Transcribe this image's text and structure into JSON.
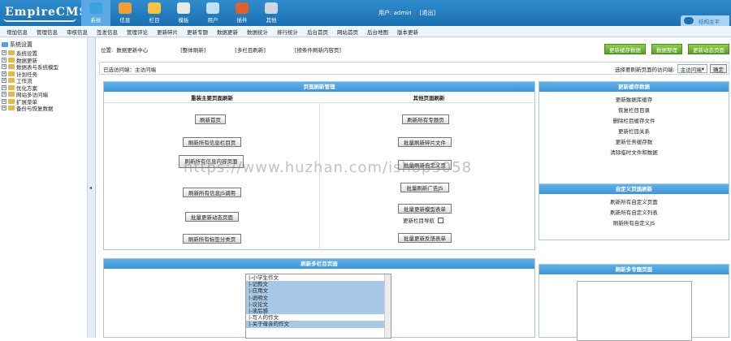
{
  "app": {
    "logo": "EmpireCMS"
  },
  "topnav": [
    {
      "label": "系统",
      "icon": "globe-icon",
      "color": "#3fa2e0"
    },
    {
      "label": "信息",
      "icon": "pencil-note-icon",
      "color": "#f0a030"
    },
    {
      "label": "栏目",
      "icon": "folder-icon",
      "color": "#f5c542"
    },
    {
      "label": "模板",
      "icon": "template-icon",
      "color": "#e8e8e8"
    },
    {
      "label": "用户",
      "icon": "user-icon",
      "color": "#bfe0f8"
    },
    {
      "label": "插件",
      "icon": "plugin-icon",
      "color": "#e06030"
    },
    {
      "label": "其他",
      "icon": "gear-icon",
      "color": "#cfd8e0"
    }
  ],
  "user": {
    "prefix": "用户:",
    "name": "admin",
    "logout": "[退出]"
  },
  "fold_label": "结构主平",
  "subnav": [
    "增加信息",
    "管理信息",
    "审核信息",
    "签发信息",
    "管理评论",
    "更新碎片",
    "更新专题",
    "数据更新",
    "数据统计",
    "排行统计",
    "后台首页",
    "网站首页",
    "后台地图",
    "版本更新"
  ],
  "sidebar": {
    "root": "系统设置",
    "items": [
      "系统设置",
      "数据更新",
      "数据表与系统模型",
      "计划任务",
      "工作流",
      "优化方案",
      "网站多访问端",
      "扩展菜单",
      "备份与恢复数据"
    ]
  },
  "location": {
    "label": "位置:",
    "path": "数据更新中心",
    "refs": [
      "[整体刷新]",
      "[多栏目刷新]",
      "[按条件刷新内容页]"
    ]
  },
  "green_buttons": [
    "更新缓存数据",
    "数据整理",
    "更新动态页面"
  ],
  "visit": {
    "current": "已选访问端：主访问端",
    "label": "选择要刷新页面的访问端:",
    "selected": "主访问端",
    "ok": "确定"
  },
  "refresh_panel": {
    "title": "页面刷新管理",
    "left_head": "重装主要页面刷新",
    "right_head": "其他页面刷新",
    "left_buttons": [
      "刷新首页",
      "刷新所有信息栏目页",
      "刷新所有信息内容页面",
      "刷新所有信息JS调用",
      "批量更新动态页面",
      "刷新所有标签分类页"
    ],
    "right_buttons": [
      "刷新所有专题页",
      "批量刷新碎片文件",
      "批量刷新自定义页",
      "批量刷新广告JS",
      "批量更新模型表单",
      "批量更新反馈表单"
    ],
    "checkbox_label": "更新栏目导航"
  },
  "cache_panel": {
    "title": "更新缓存数据",
    "items": [
      "更新数据库缓存",
      "恢复栏目目录",
      "删除栏目缓存文件",
      "更新栏目关系",
      "更新任务缓存数",
      "清除临时文件和数据"
    ]
  },
  "custom_panel": {
    "title": "自定义页面刷新",
    "items": [
      "刷新所有自定义页面",
      "刷新所有自定义列表",
      "刷新所有自定义JS"
    ]
  },
  "multi_panel": {
    "title": "刷新多栏目页面",
    "options": [
      "|-小学生作文",
      "|-记叙文",
      "|-应用文",
      "|-说明文",
      "|-议论文",
      "|-读后感",
      "|-写人的作文",
      "|-关于母亲的作文"
    ]
  },
  "topic_panel": {
    "title": "刷新多专题页面"
  },
  "watermark": "https://www.huzhan.com/ishop3058"
}
